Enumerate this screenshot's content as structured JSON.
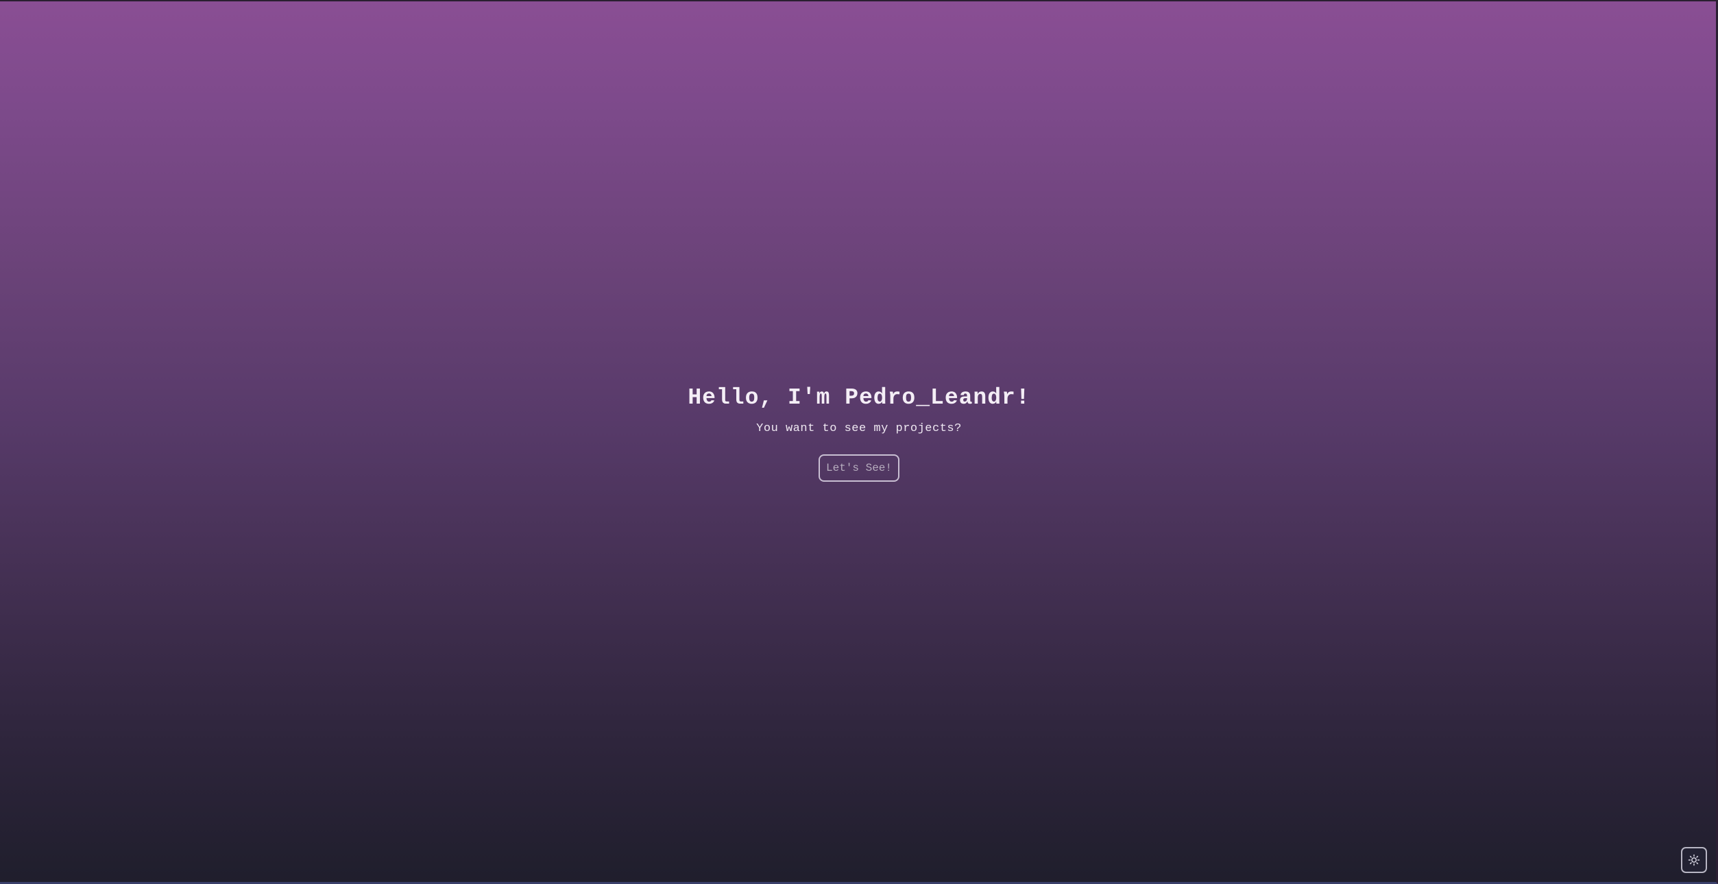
{
  "hero": {
    "title": "Hello, I'm Pedro_Leandr!",
    "subtitle": "You want to see my projects?",
    "cta_label": "Let's See!"
  },
  "theme_toggle": {
    "icon": "sun-icon"
  },
  "colors": {
    "gradient_top": "#8a4e94",
    "gradient_bottom": "#1f1e2c",
    "text": "#f4eef6",
    "button_border": "#c9bfd3"
  }
}
